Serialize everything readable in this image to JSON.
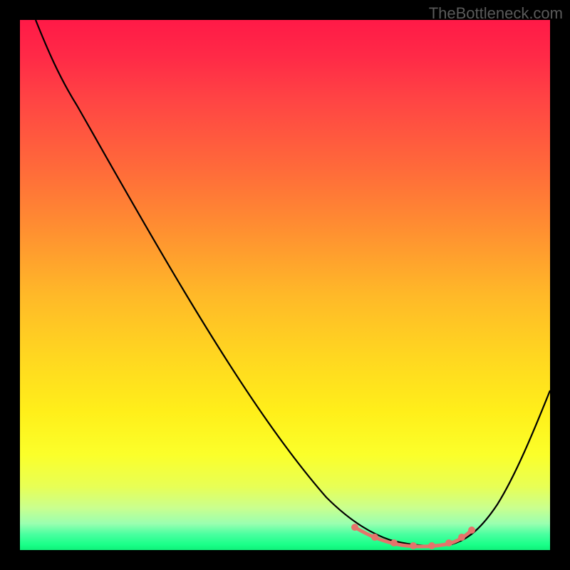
{
  "watermark": "TheBottleneck.com",
  "chart_data": {
    "type": "line",
    "title": "",
    "xlabel": "",
    "ylabel": "",
    "xlim": [
      0,
      100
    ],
    "ylim": [
      0,
      100
    ],
    "grid": false,
    "legend": false,
    "series": [
      {
        "name": "curve",
        "x": [
          3,
          8,
          14,
          20,
          26,
          32,
          38,
          44,
          50,
          56,
          60,
          64,
          67,
          70,
          73,
          76,
          79,
          82,
          85,
          88,
          91,
          94,
          97,
          100
        ],
        "y": [
          100,
          93,
          84,
          75,
          66,
          57,
          48,
          39,
          30,
          21,
          15,
          10,
          7,
          4.5,
          3,
          2.2,
          2,
          2.3,
          3.3,
          6,
          10,
          16,
          24,
          33
        ]
      },
      {
        "name": "optimal-zone",
        "x": [
          67,
          70,
          73,
          76,
          79,
          82,
          84
        ],
        "y": [
          7,
          4.5,
          3,
          2.2,
          2,
          2.3,
          3
        ]
      }
    ],
    "background_gradient": {
      "top": "#ff1a47",
      "mid_upper": "#ff8a32",
      "mid": "#ffd820",
      "mid_lower": "#fbff2a",
      "bottom": "#10f07a"
    }
  }
}
